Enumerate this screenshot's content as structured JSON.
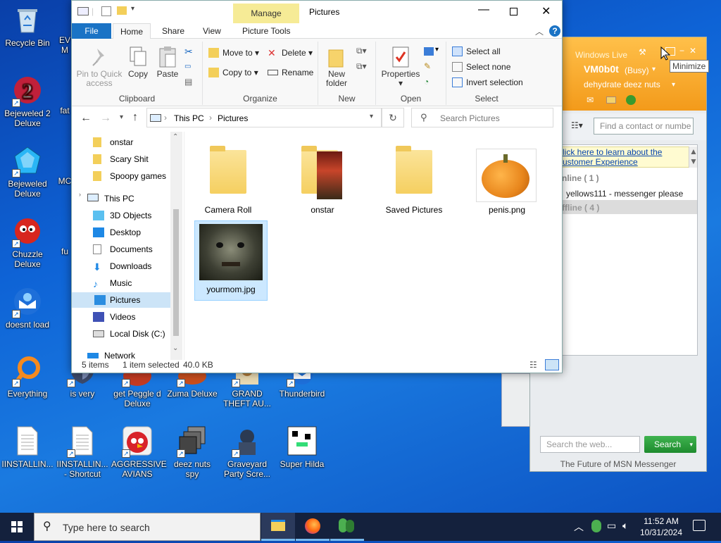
{
  "desktop_icons": [
    {
      "label": "Recycle Bin",
      "icon": "recycle-bin-icon"
    },
    {
      "label": "Bejeweled 2 Deluxe",
      "icon": "bejeweled2-icon"
    },
    {
      "label": "Bejeweled Deluxe",
      "icon": "bejeweled-icon"
    },
    {
      "label": "Chuzzle Deluxe",
      "icon": "chuzzle-icon"
    },
    {
      "label": "doesnt load",
      "icon": "thunderbird-icon"
    },
    {
      "label": "Everything",
      "icon": "everything-search-icon"
    },
    {
      "label": "is very",
      "icon": "shield-icon"
    },
    {
      "label": "get Peggle d Deluxe",
      "icon": "peggle-icon"
    },
    {
      "label": "Zuma Deluxe",
      "icon": "zuma-icon"
    },
    {
      "label": "GRAND THEFT AU...",
      "icon": "gta-icon"
    },
    {
      "label": "Thunderbird",
      "icon": "thunderbird-icon"
    },
    {
      "label": "IINSTALLIN...",
      "icon": "text-file-icon"
    },
    {
      "label": "IINSTALLIN... - Shortcut",
      "icon": "text-file-icon"
    },
    {
      "label": "AGGRESSIVE AVIANS",
      "icon": "angry-bird-icon"
    },
    {
      "label": "deez nuts spy",
      "icon": "windows-stack-icon"
    },
    {
      "label": "Graveyard Party Scre...",
      "icon": "graveyard-icon"
    },
    {
      "label": "Super Hilda",
      "icon": "super-hilda-icon"
    },
    {
      "label": "EV M",
      "icon": "app-icon"
    },
    {
      "label": "fat",
      "icon": "app-icon"
    },
    {
      "label": "MC",
      "icon": "app-icon"
    },
    {
      "label": "fu",
      "icon": "app-icon"
    }
  ],
  "explorer": {
    "title": "Pictures",
    "manage_tab": "Manage",
    "tabs": [
      "File",
      "Home",
      "Share",
      "View",
      "Picture Tools"
    ],
    "ribbon": {
      "clipboard": {
        "label": "Clipboard",
        "pin": "Pin to Quick access",
        "copy": "Copy",
        "paste": "Paste"
      },
      "organize": {
        "label": "Organize",
        "move_to": "Move to",
        "copy_to": "Copy to",
        "delete": "Delete",
        "rename": "Rename"
      },
      "new": {
        "label": "New",
        "new_folder": "New folder"
      },
      "open": {
        "label": "Open",
        "properties": "Properties"
      },
      "select": {
        "label": "Select",
        "select_all": "Select all",
        "select_none": "Select none",
        "invert": "Invert selection"
      }
    },
    "breadcrumb": [
      "This PC",
      "Pictures"
    ],
    "search_placeholder": "Search Pictures",
    "nav_items": [
      "onstar",
      "Scary Shit",
      "Spoopy games",
      "This PC",
      "3D Objects",
      "Desktop",
      "Documents",
      "Downloads",
      "Music",
      "Pictures",
      "Videos",
      "Local Disk (C:)",
      "Network"
    ],
    "files": [
      "Camera Roll",
      "onstar",
      "Saved Pictures",
      "penis.png",
      "yourmom.jpg"
    ],
    "status": {
      "count": "5 items",
      "selected": "1 item selected",
      "size": "40.0 KB"
    }
  },
  "msn": {
    "title": "Windows Live",
    "tooltip": "Minimize",
    "username": "VM0b0t",
    "status": "(Busy)",
    "personal_message": "dehydrate deez nuts",
    "find_placeholder": "Find a contact or numbe",
    "info_link_1": "lick here to learn about the",
    "info_link_2": "ustomer Experience",
    "online_header": "nline ( 1 )",
    "contact": "yellows111 - messenger please",
    "offline_header": "ffline ( 4 )",
    "search_placeholder": "Search the web...",
    "search_button": "Search",
    "footer": "The Future of MSN Messenger"
  },
  "taskbar": {
    "search_placeholder": "Type here to search",
    "time": "11:52 AM",
    "date": "10/31/2024"
  }
}
